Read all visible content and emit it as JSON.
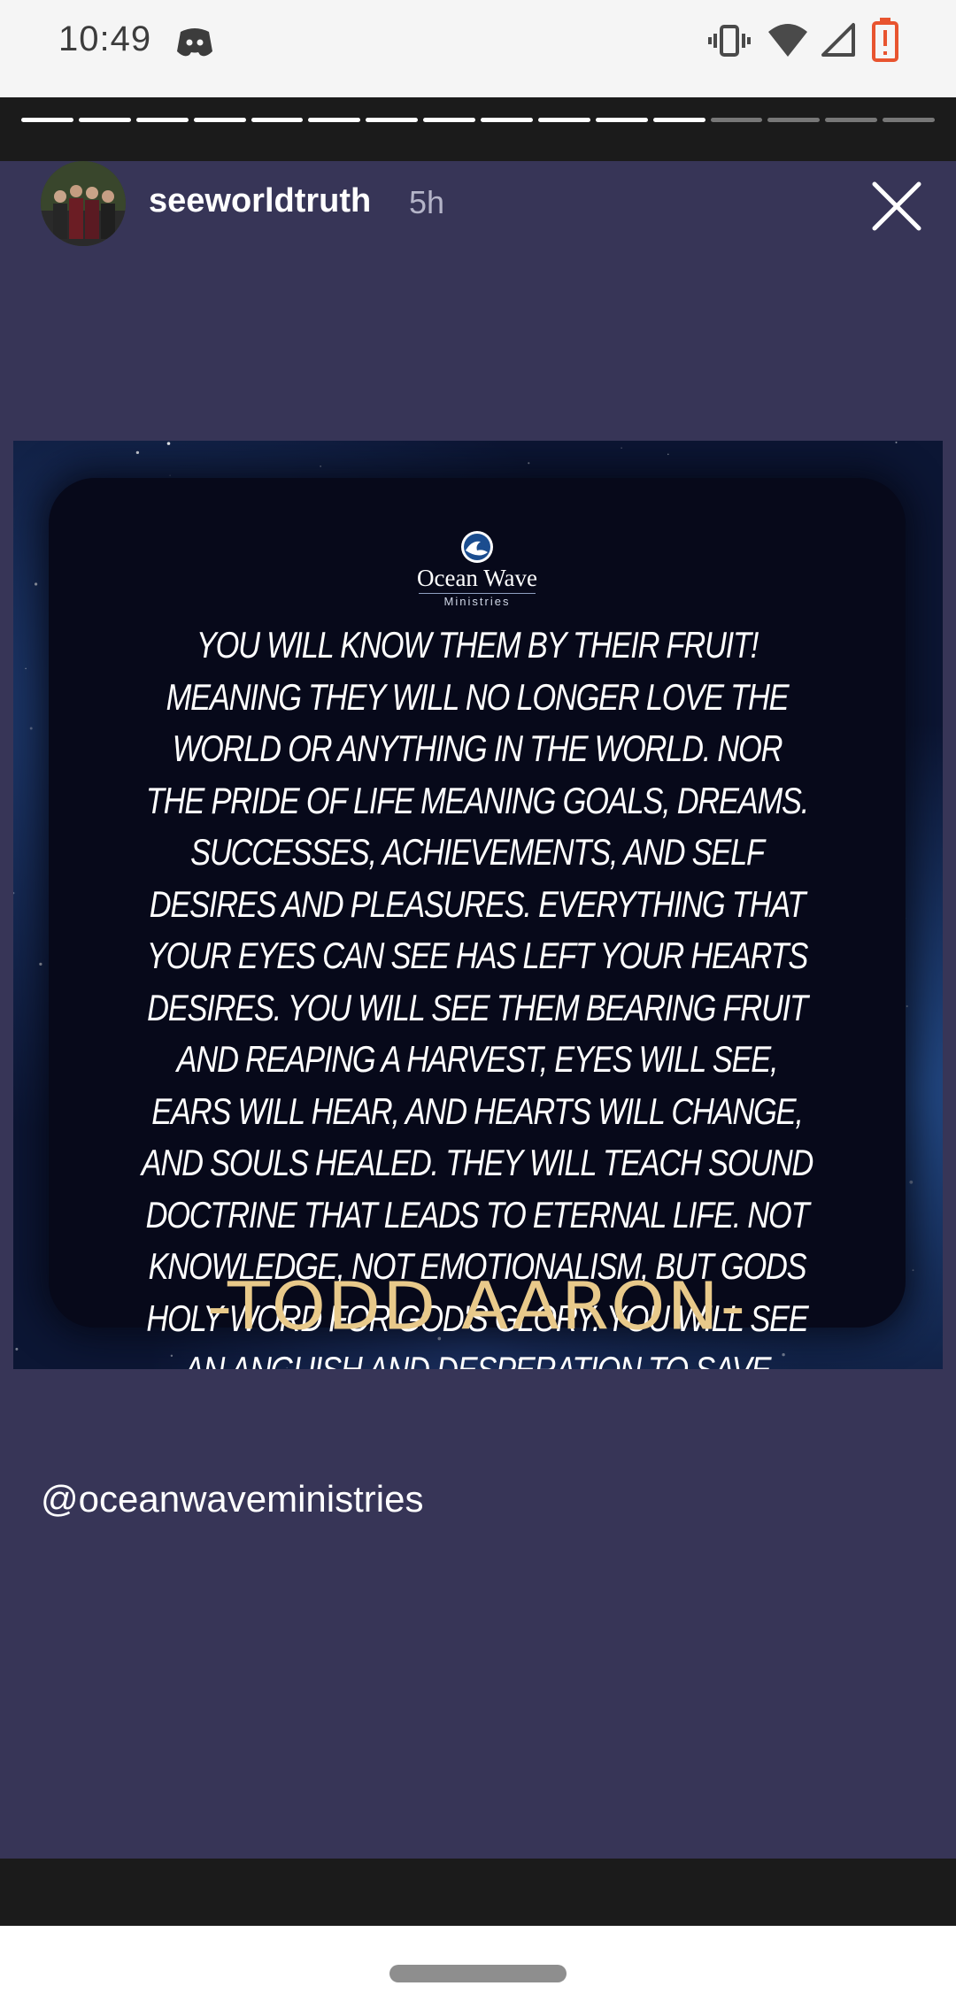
{
  "status_bar": {
    "time": "10:49",
    "icons": [
      "discord-icon",
      "vibrate-icon",
      "wifi-icon",
      "cell-signal-icon",
      "battery-low-icon"
    ],
    "battery_color": "#e8542f"
  },
  "story": {
    "segments_total": 16,
    "segments_viewed": 12,
    "author": {
      "username": "seeworldtruth",
      "posted_ago": "5h"
    },
    "image": {
      "logo": {
        "name": "Ocean Wave",
        "subtitle": "Ministries"
      },
      "quote": "YOU WILL KNOW THEM BY THEIR FRUIT! MEANING THEY WILL NO LONGER LOVE THE WORLD OR ANYTHING IN THE WORLD. NOR THE PRIDE OF LIFE MEANING GOALS, DREAMS. SUCCESSES, ACHIEVEMENTS, AND SELF DESIRES AND PLEASURES. EVERYTHING THAT YOUR EYES CAN SEE HAS LEFT YOUR HEARTS DESIRES. YOU WILL SEE THEM BEARING FRUIT AND REAPING A HARVEST, EYES WILL SEE, EARS WILL HEAR, AND HEARTS WILL CHANGE, AND SOULS HEALED. THEY WILL TEACH SOUND DOCTRINE THAT LEADS TO ETERNAL LIFE. NOT KNOWLEDGE, NOT EMOTIONALISM, BUT GODS HOLY WORD FOR GOD'S GLORY. YOU WILL SEE AN ANGUISH AND DESPERATION TO SAVE PEOPLE, AND A SINCERE LOVE FOR THEIR BROTHERS AND SISTERS IN YESHUA.",
      "attribution": "-TODD AARON-"
    },
    "mention": "@oceanwaveministries",
    "colors": {
      "card_background": "#373557",
      "quote_author": "#e8c98a"
    }
  }
}
